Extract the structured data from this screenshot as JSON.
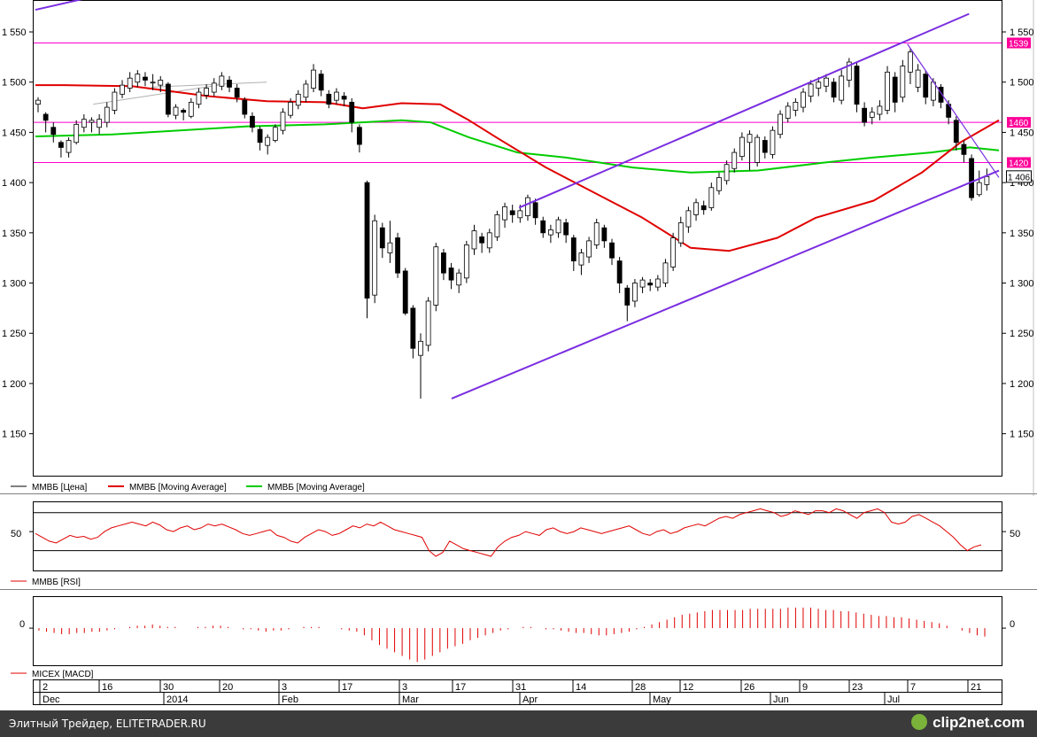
{
  "chart_data": {
    "type": "candlestick",
    "title": "",
    "price_axis": {
      "range": [
        1110,
        1580
      ],
      "ticks": [
        1150,
        1200,
        1250,
        1300,
        1350,
        1400,
        1450,
        1500,
        1550
      ],
      "tick_labels": [
        "1 150",
        "1 200",
        "1 250",
        "1 300",
        "1 350",
        "1 400",
        "1 450",
        "1 500",
        "1 550"
      ]
    },
    "horizontal_levels": [
      {
        "value": 1539,
        "label": "1539"
      },
      {
        "value": 1460,
        "label": "1460"
      },
      {
        "value": 1420,
        "label": "1420"
      }
    ],
    "last_price": {
      "value": 1406,
      "label": "1 406"
    },
    "candles": [
      [
        1478,
        1482,
        1470,
        1485,
        1475
      ],
      [
        1468,
        1462,
        1450,
        1470,
        1455
      ],
      [
        1455,
        1448,
        1440,
        1460,
        1445
      ],
      [
        1440,
        1435,
        1425,
        1442,
        1430
      ],
      [
        1430,
        1442,
        1425,
        1445,
        1440
      ],
      [
        1440,
        1458,
        1438,
        1462,
        1455
      ],
      [
        1455,
        1463,
        1450,
        1468,
        1460
      ],
      [
        1460,
        1462,
        1450,
        1465,
        1455
      ],
      [
        1455,
        1463,
        1448,
        1468,
        1460
      ],
      [
        1460,
        1475,
        1455,
        1480,
        1472
      ],
      [
        1472,
        1490,
        1468,
        1494,
        1488
      ],
      [
        1488,
        1497,
        1484,
        1502,
        1494
      ],
      [
        1494,
        1504,
        1490,
        1510,
        1500
      ],
      [
        1500,
        1508,
        1495,
        1512,
        1505
      ],
      [
        1505,
        1502,
        1496,
        1510,
        1500
      ],
      [
        1500,
        1500,
        1492,
        1508,
        1497
      ],
      [
        1497,
        1502,
        1490,
        1506,
        1498
      ],
      [
        1498,
        1468,
        1465,
        1500,
        1467
      ],
      [
        1467,
        1475,
        1463,
        1478,
        1472
      ],
      [
        1472,
        1470,
        1462,
        1474,
        1466
      ],
      [
        1466,
        1480,
        1464,
        1484,
        1478
      ],
      [
        1478,
        1490,
        1474,
        1494,
        1487
      ],
      [
        1487,
        1494,
        1483,
        1498,
        1490
      ],
      [
        1490,
        1499,
        1486,
        1504,
        1496
      ],
      [
        1496,
        1506,
        1492,
        1510,
        1502
      ],
      [
        1502,
        1495,
        1490,
        1506,
        1494
      ],
      [
        1494,
        1485,
        1480,
        1498,
        1482
      ],
      [
        1482,
        1468,
        1464,
        1485,
        1466
      ],
      [
        1466,
        1455,
        1450,
        1470,
        1453
      ],
      [
        1453,
        1440,
        1432,
        1456,
        1437
      ],
      [
        1437,
        1445,
        1428,
        1448,
        1442
      ],
      [
        1442,
        1455,
        1440,
        1458,
        1452
      ],
      [
        1452,
        1470,
        1448,
        1474,
        1467
      ],
      [
        1467,
        1480,
        1464,
        1484,
        1477
      ],
      [
        1477,
        1488,
        1473,
        1492,
        1485
      ],
      [
        1485,
        1498,
        1480,
        1502,
        1494
      ],
      [
        1494,
        1512,
        1490,
        1518,
        1508
      ],
      [
        1508,
        1492,
        1486,
        1512,
        1488
      ],
      [
        1488,
        1478,
        1474,
        1492,
        1482
      ],
      [
        1482,
        1490,
        1478,
        1494,
        1486
      ],
      [
        1486,
        1483,
        1476,
        1490,
        1480
      ],
      [
        1480,
        1460,
        1450,
        1484,
        1455
      ],
      [
        1455,
        1438,
        1430,
        1458,
        1440
      ],
      [
        1400,
        1285,
        1265,
        1402,
        1288
      ],
      [
        1288,
        1362,
        1280,
        1368,
        1355
      ],
      [
        1355,
        1335,
        1325,
        1360,
        1330
      ],
      [
        1330,
        1340,
        1320,
        1362,
        1345
      ],
      [
        1345,
        1310,
        1305,
        1350,
        1312
      ],
      [
        1312,
        1270,
        1268,
        1315,
        1275
      ],
      [
        1275,
        1235,
        1225,
        1278,
        1228
      ],
      [
        1228,
        1242,
        1185,
        1250,
        1238
      ],
      [
        1238,
        1282,
        1232,
        1286,
        1278
      ],
      [
        1278,
        1336,
        1272,
        1340,
        1330
      ],
      [
        1330,
        1310,
        1303,
        1334,
        1315
      ],
      [
        1315,
        1303,
        1294,
        1320,
        1298
      ],
      [
        1298,
        1310,
        1290,
        1314,
        1305
      ],
      [
        1305,
        1338,
        1300,
        1342,
        1334
      ],
      [
        1334,
        1352,
        1328,
        1358,
        1346
      ],
      [
        1346,
        1340,
        1330,
        1350,
        1335
      ],
      [
        1335,
        1350,
        1330,
        1354,
        1346
      ],
      [
        1346,
        1368,
        1342,
        1372,
        1363
      ],
      [
        1363,
        1376,
        1355,
        1380,
        1372
      ],
      [
        1372,
        1368,
        1360,
        1378,
        1365
      ],
      [
        1365,
        1372,
        1360,
        1378,
        1367
      ],
      [
        1367,
        1385,
        1362,
        1388,
        1380
      ],
      [
        1380,
        1365,
        1358,
        1384,
        1362
      ],
      [
        1362,
        1350,
        1345,
        1366,
        1348
      ],
      [
        1348,
        1353,
        1340,
        1358,
        1350
      ],
      [
        1350,
        1363,
        1345,
        1366,
        1360
      ],
      [
        1360,
        1348,
        1340,
        1364,
        1345
      ],
      [
        1345,
        1322,
        1312,
        1348,
        1318
      ],
      [
        1318,
        1330,
        1308,
        1334,
        1326
      ],
      [
        1326,
        1342,
        1320,
        1346,
        1338
      ],
      [
        1338,
        1360,
        1334,
        1364,
        1355
      ],
      [
        1355,
        1342,
        1335,
        1358,
        1340
      ],
      [
        1340,
        1325,
        1318,
        1344,
        1322
      ],
      [
        1322,
        1300,
        1290,
        1326,
        1295
      ],
      [
        1295,
        1278,
        1262,
        1298,
        1282
      ],
      [
        1282,
        1300,
        1276,
        1304,
        1296
      ],
      [
        1296,
        1303,
        1290,
        1306,
        1300
      ],
      [
        1300,
        1298,
        1292,
        1304,
        1296
      ],
      [
        1296,
        1304,
        1292,
        1308,
        1300
      ],
      [
        1300,
        1320,
        1296,
        1324,
        1316
      ],
      [
        1316,
        1345,
        1312,
        1350,
        1340
      ],
      [
        1340,
        1360,
        1336,
        1366,
        1356
      ],
      [
        1356,
        1372,
        1350,
        1376,
        1368
      ],
      [
        1368,
        1380,
        1362,
        1384,
        1377
      ],
      [
        1377,
        1373,
        1368,
        1382,
        1375
      ],
      [
        1375,
        1395,
        1372,
        1400,
        1392
      ],
      [
        1392,
        1405,
        1388,
        1410,
        1402
      ],
      [
        1402,
        1418,
        1398,
        1422,
        1414
      ],
      [
        1414,
        1430,
        1410,
        1434,
        1426
      ],
      [
        1426,
        1445,
        1422,
        1450,
        1440
      ],
      [
        1440,
        1448,
        1412,
        1452,
        1420
      ],
      [
        1420,
        1445,
        1416,
        1448,
        1442
      ],
      [
        1442,
        1430,
        1424,
        1446,
        1428
      ],
      [
        1428,
        1452,
        1424,
        1456,
        1448
      ],
      [
        1448,
        1468,
        1444,
        1472,
        1464
      ],
      [
        1464,
        1476,
        1460,
        1480,
        1472
      ],
      [
        1472,
        1480,
        1466,
        1484,
        1475
      ],
      [
        1475,
        1490,
        1470,
        1494,
        1486
      ],
      [
        1486,
        1498,
        1480,
        1502,
        1494
      ],
      [
        1494,
        1500,
        1486,
        1505,
        1496
      ],
      [
        1496,
        1504,
        1490,
        1508,
        1500
      ],
      [
        1500,
        1485,
        1480,
        1504,
        1482
      ],
      [
        1482,
        1506,
        1478,
        1512,
        1502
      ],
      [
        1502,
        1520,
        1495,
        1524,
        1516
      ],
      [
        1516,
        1478,
        1470,
        1520,
        1474
      ],
      [
        1474,
        1460,
        1456,
        1480,
        1465
      ],
      [
        1465,
        1470,
        1458,
        1475,
        1468
      ],
      [
        1468,
        1476,
        1462,
        1482,
        1472
      ],
      [
        1472,
        1510,
        1468,
        1516,
        1505
      ],
      [
        1505,
        1480,
        1470,
        1510,
        1485
      ],
      [
        1485,
        1516,
        1480,
        1522,
        1510
      ],
      [
        1510,
        1530,
        1498,
        1534,
        1495
      ],
      [
        1495,
        1512,
        1490,
        1518,
        1508
      ],
      [
        1508,
        1485,
        1478,
        1512,
        1482
      ],
      [
        1482,
        1500,
        1476,
        1504,
        1495
      ],
      [
        1495,
        1480,
        1474,
        1498,
        1478
      ],
      [
        1478,
        1465,
        1458,
        1482,
        1462
      ],
      [
        1462,
        1440,
        1432,
        1466,
        1438
      ],
      [
        1438,
        1428,
        1420,
        1442,
        1424
      ],
      [
        1424,
        1385,
        1382,
        1428,
        1388
      ],
      [
        1388,
        1400,
        1386,
        1412,
        1398
      ],
      [
        1398,
        1406,
        1392,
        1414,
        1404
      ]
    ],
    "ma_fast": [
      [
        0,
        1497
      ],
      [
        0.03,
        1497
      ],
      [
        0.1,
        1496
      ],
      [
        0.18,
        1486
      ],
      [
        0.24,
        1481
      ],
      [
        0.3,
        1480
      ],
      [
        0.34,
        1474
      ],
      [
        0.38,
        1479
      ],
      [
        0.42,
        1478
      ],
      [
        0.45,
        1462
      ],
      [
        0.48,
        1444
      ],
      [
        0.53,
        1415
      ],
      [
        0.58,
        1390
      ],
      [
        0.63,
        1365
      ],
      [
        0.68,
        1335
      ],
      [
        0.72,
        1332
      ],
      [
        0.77,
        1345
      ],
      [
        0.81,
        1365
      ],
      [
        0.87,
        1382
      ],
      [
        0.92,
        1410
      ],
      [
        0.96,
        1440
      ],
      [
        1.0,
        1462
      ]
    ],
    "ma_slow": [
      [
        0,
        1446
      ],
      [
        0.08,
        1448
      ],
      [
        0.15,
        1452
      ],
      [
        0.22,
        1456
      ],
      [
        0.3,
        1458
      ],
      [
        0.38,
        1462
      ],
      [
        0.41,
        1460
      ],
      [
        0.45,
        1445
      ],
      [
        0.5,
        1430
      ],
      [
        0.55,
        1425
      ],
      [
        0.62,
        1415
      ],
      [
        0.68,
        1410
      ],
      [
        0.75,
        1412
      ],
      [
        0.82,
        1420
      ],
      [
        0.87,
        1425
      ],
      [
        0.93,
        1430
      ],
      [
        0.97,
        1435
      ],
      [
        1.0,
        1432
      ]
    ],
    "trend_lines": [
      {
        "name": "channel-upper",
        "from": [
          0.502,
          1375
        ],
        "to": [
          0.969,
          1568
        ]
      },
      {
        "name": "channel-lower",
        "from": [
          0.432,
          1185
        ],
        "to": [
          1.0,
          1412
        ]
      },
      {
        "name": "down-trend",
        "from": [
          0.905,
          1538
        ],
        "to": [
          1.0,
          1405
        ]
      },
      {
        "name": "top-left-fragment",
        "from": [
          0.0,
          1572
        ],
        "to": [
          0.055,
          1584
        ]
      }
    ],
    "grid_lines_gray": [
      {
        "from": [
          0.06,
          1478
        ],
        "to": [
          0.19,
          1497
        ]
      },
      {
        "from": [
          0.12,
          1495
        ],
        "to": [
          0.24,
          1500
        ]
      }
    ],
    "legend": [
      {
        "label": "ММВБ [Цена]",
        "color": "#000000"
      },
      {
        "label": "ММВБ [Moving Average]",
        "color": "#e00000"
      },
      {
        "label": "ММВБ [Moving Average]",
        "color": "#00cc00"
      }
    ],
    "rsi": {
      "label": "ММВБ [RSI]",
      "axis_label": "50",
      "levels": [
        70,
        30
      ],
      "values": [
        48,
        44,
        40,
        38,
        42,
        46,
        44,
        45,
        42,
        44,
        50,
        54,
        56,
        58,
        60,
        58,
        56,
        60,
        57,
        52,
        50,
        54,
        56,
        52,
        54,
        58,
        56,
        58,
        55,
        52,
        48,
        46,
        48,
        50,
        52,
        46,
        44,
        40,
        38,
        44,
        48,
        52,
        50,
        46,
        48,
        52,
        56,
        54,
        58,
        56,
        60,
        56,
        52,
        50,
        48,
        46,
        44,
        30,
        24,
        28,
        40,
        36,
        32,
        30,
        28,
        26,
        24,
        34,
        40,
        44,
        46,
        50,
        48,
        46,
        52,
        54,
        50,
        48,
        50,
        54,
        52,
        50,
        48,
        50,
        52,
        54,
        56,
        52,
        48,
        46,
        50,
        52,
        48,
        50,
        54,
        56,
        58,
        56,
        60,
        64,
        66,
        64,
        68,
        70,
        72,
        74,
        72,
        70,
        66,
        68,
        72,
        70,
        68,
        72,
        72,
        70,
        74,
        72,
        68,
        64,
        70,
        72,
        74,
        70,
        60,
        58,
        60,
        66,
        68,
        64,
        60,
        56,
        50,
        44,
        36,
        30,
        34,
        36
      ],
      "ylim": [
        10,
        80
      ]
    },
    "macd": {
      "label": "MICEX [MACD]",
      "axis_label": "0",
      "values": [
        -2,
        -3,
        -4,
        -5,
        -5,
        -4,
        -4,
        -3,
        -3,
        -2,
        -1,
        0,
        1,
        2,
        2,
        3,
        2,
        1,
        1,
        0,
        0,
        1,
        1,
        2,
        2,
        1,
        0,
        -1,
        -1,
        -2,
        -3,
        -2,
        -2,
        -1,
        0,
        1,
        1,
        1,
        0,
        0,
        -1,
        -2,
        -3,
        -6,
        -10,
        -14,
        -17,
        -20,
        -23,
        -26,
        -28,
        -26,
        -23,
        -20,
        -17,
        -15,
        -13,
        -10,
        -8,
        -6,
        -4,
        -2,
        -1,
        0,
        1,
        1,
        0,
        -1,
        -1,
        -2,
        -3,
        -4,
        -4,
        -5,
        -6,
        -6,
        -5,
        -4,
        -3,
        -1,
        1,
        3,
        5,
        7,
        9,
        11,
        12,
        13,
        14,
        15,
        15,
        15,
        15,
        15,
        16,
        16,
        16,
        16,
        16,
        17,
        17,
        17,
        17,
        16,
        15,
        15,
        14,
        14,
        13,
        12,
        11,
        10,
        10,
        9,
        9,
        8,
        7,
        6,
        5,
        4,
        2,
        0,
        -2,
        -4,
        -6,
        -7
      ],
      "ylim": [
        -30,
        25
      ]
    },
    "x_axis": {
      "day_labels": [
        "2",
        "16",
        "30",
        "20",
        "3",
        "17",
        "3",
        "17",
        "31",
        "14",
        "28",
        "12",
        "26",
        "9",
        "23",
        "7",
        "21"
      ],
      "month_labels": [
        "Dec",
        "2014",
        "Feb",
        "Mar",
        "Apr",
        "May",
        "Jun",
        "Jul"
      ]
    }
  },
  "colors": {
    "magenta_level": "#ff00cc",
    "channel_purple": "#7a2ee0",
    "ma_fast": "#e00000",
    "ma_slow": "#00cc00",
    "rsi_line": "#e00000",
    "macd_bar": "#e00000",
    "tag_fill": "#ff0099"
  },
  "footer": {
    "left_text": "Элитный Трейдер, ELITETRADER.RU",
    "right_brand": "clip2net.com"
  }
}
